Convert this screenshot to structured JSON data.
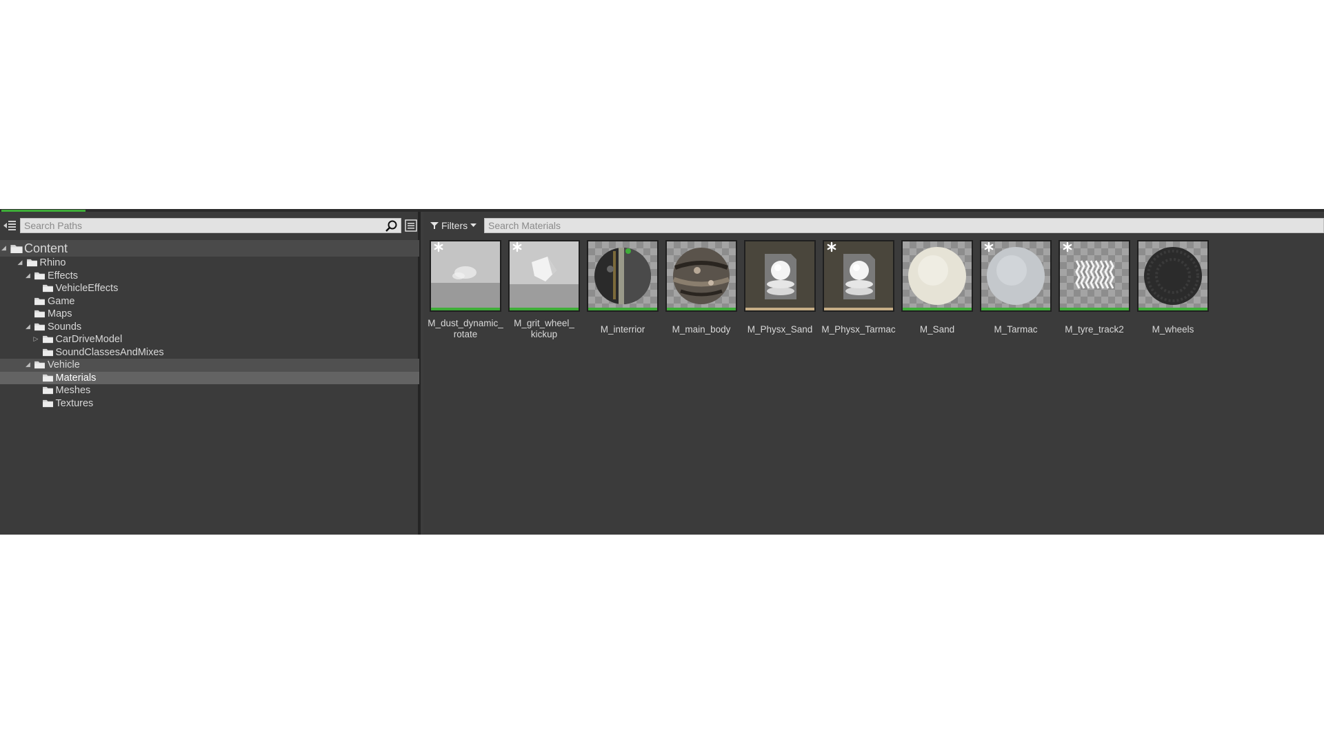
{
  "colors": {
    "accent": "#3fae39",
    "panel_bg": "#3b3b3b",
    "selection": "#636363",
    "physx_bar": "#c7ae86"
  },
  "paths_panel": {
    "search_placeholder": "Search Paths",
    "tree": [
      {
        "label": "Content",
        "depth": 0,
        "expanded": true,
        "root": true
      },
      {
        "label": "Rhino",
        "depth": 1,
        "expanded": true
      },
      {
        "label": "Effects",
        "depth": 2,
        "expanded": true
      },
      {
        "label": "VehicleEffects",
        "depth": 3
      },
      {
        "label": "Game",
        "depth": 2
      },
      {
        "label": "Maps",
        "depth": 2
      },
      {
        "label": "Sounds",
        "depth": 2,
        "expanded": true
      },
      {
        "label": "CarDriveModel",
        "depth": 3,
        "collapsed": true
      },
      {
        "label": "SoundClassesAndMixes",
        "depth": 3
      },
      {
        "label": "Vehicle",
        "depth": 2,
        "expanded": true,
        "highlight": true
      },
      {
        "label": "Materials",
        "depth": 3,
        "selected": true
      },
      {
        "label": "Meshes",
        "depth": 3
      },
      {
        "label": "Textures",
        "depth": 3
      }
    ]
  },
  "assets_panel": {
    "filters_label": "Filters",
    "search_placeholder": "Search Materials",
    "assets": [
      {
        "name": "M_dust_dynamic_rotate",
        "line1": "M_dust_dynamic_",
        "line2": "rotate",
        "thumb": "dust",
        "star": true,
        "bar": "green"
      },
      {
        "name": "M_grit_wheel_kickup",
        "line1": "M_grit_wheel_",
        "line2": "kickup",
        "thumb": "grit",
        "star": true,
        "bar": "green"
      },
      {
        "name": "M_interrior",
        "line1": "M_interrior",
        "line2": "",
        "thumb": "interior",
        "star": false,
        "bar": "green"
      },
      {
        "name": "M_main_body",
        "line1": "M_main_body",
        "line2": "",
        "thumb": "body",
        "star": false,
        "bar": "green"
      },
      {
        "name": "M_Physx_Sand",
        "line1": "M_Physx_Sand",
        "line2": "",
        "thumb": "physx",
        "star": false,
        "bar": "tan"
      },
      {
        "name": "M_Physx_Tarmac",
        "line1": "M_Physx_Tarmac",
        "line2": "",
        "thumb": "physx",
        "star": true,
        "bar": "tan"
      },
      {
        "name": "M_Sand",
        "line1": "M_Sand",
        "line2": "",
        "thumb": "sand",
        "star": false,
        "bar": "green"
      },
      {
        "name": "M_Tarmac",
        "line1": "M_Tarmac",
        "line2": "",
        "thumb": "tarmac",
        "star": true,
        "bar": "green"
      },
      {
        "name": "M_tyre_track2",
        "line1": "M_tyre_track2",
        "line2": "",
        "thumb": "tyre",
        "star": true,
        "bar": "green"
      },
      {
        "name": "M_wheels",
        "line1": "M_wheels",
        "line2": "",
        "thumb": "wheels",
        "star": false,
        "bar": "green"
      }
    ]
  }
}
